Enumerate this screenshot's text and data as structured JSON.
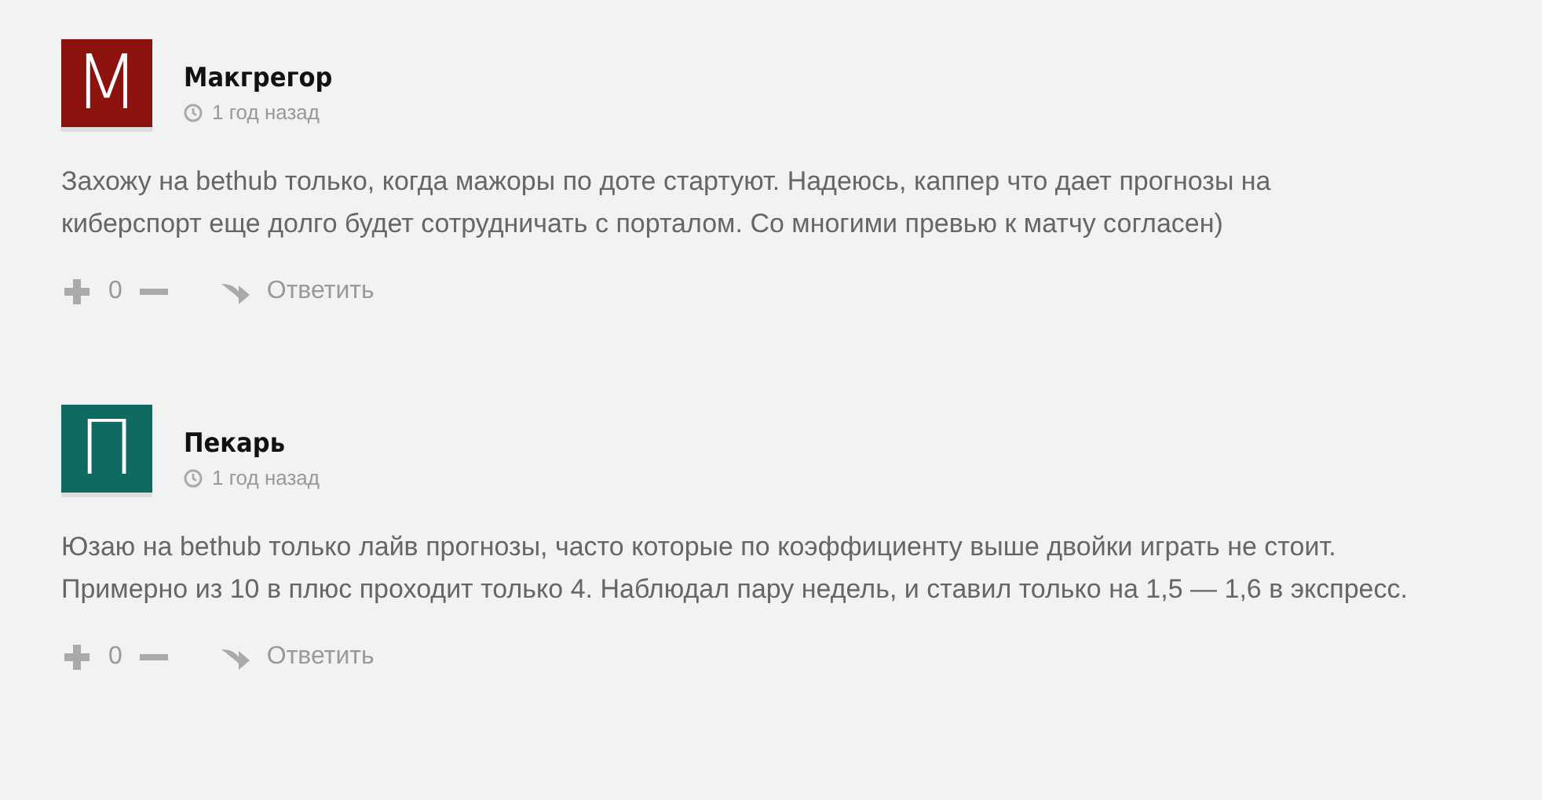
{
  "comments": [
    {
      "avatar": {
        "letter": "М",
        "color": "#8b120d"
      },
      "author": "Макгрегор",
      "time": "1 год назад",
      "text": "Захожу на bethub только, когда мажоры по доте стартуют. Надеюсь, каппер что дает прогнозы на киберспорт еще долго будет сотрудничать с порталом. Со многими превью к матчу согласен)",
      "votes": "0",
      "reply": "Ответить"
    },
    {
      "avatar": {
        "letter": "П",
        "color": "#0f6b62"
      },
      "author": "Пекарь",
      "time": "1 год назад",
      "text": "Юзаю на bethub только лайв прогнозы, часто которые по коэффициенту выше двойки играть не стоит. Примерно из 10 в плюс проходит только 4. Наблюдал пару недель, и ставил только на 1,5 — 1,6 в экспресс.",
      "votes": "0",
      "reply": "Ответить"
    }
  ]
}
